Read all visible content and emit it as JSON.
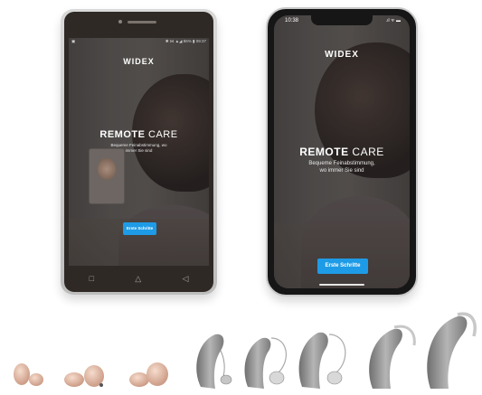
{
  "android": {
    "status_left": "▣",
    "status_right": "✱ ⋈ ▲◢ 86% ▮ 09:37",
    "logo": "WIDEX",
    "title_bold": "REMOTE",
    "title_light": "CARE",
    "subtitle_line1": "Bequeme Feinabstimmung, wo",
    "subtitle_line2": "immer Sie sind",
    "button_label": "Erste Schritte",
    "nav_recent": "□",
    "nav_home": "△",
    "nav_back": "◁"
  },
  "iphone": {
    "time": "10:38",
    "signal": ".ıl ᯤ ▬",
    "logo": "WIDEX",
    "title_bold": "REMOTE",
    "title_light": "CARE",
    "subtitle_line1": "Bequeme Feinabstimmung,",
    "subtitle_line2": "wo immer Sie sind",
    "button_label": "Erste Schritte"
  },
  "colors": {
    "button": "#1e9be6",
    "skin_aid": "#e9c1ad",
    "gray_aid": "#8e8e8e"
  }
}
